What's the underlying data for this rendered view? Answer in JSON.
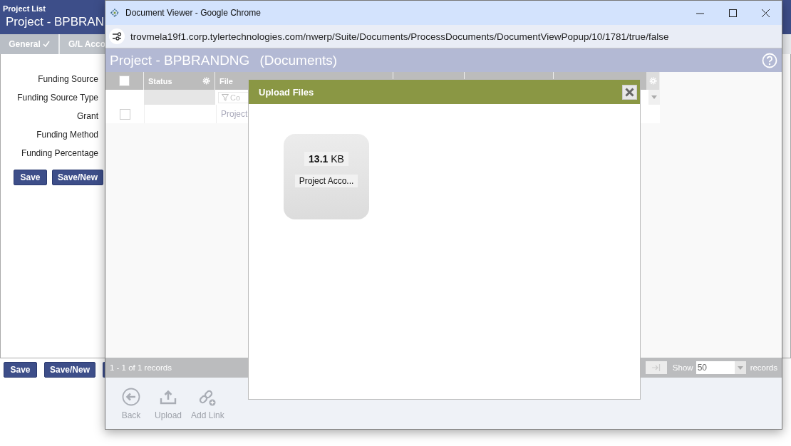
{
  "background_app": {
    "breadcrumb": "Project List",
    "title": "Project - BPBRAN",
    "tabs": [
      {
        "label": "General",
        "checked": true
      },
      {
        "label": "G/L Acco"
      }
    ],
    "form_labels": [
      "Funding Source",
      "Funding Source Type",
      "Grant",
      "Funding Method",
      "Funding Percentage"
    ],
    "form_buttons": [
      "Save",
      "Save/New"
    ],
    "footer_buttons": [
      "Save",
      "Save/New"
    ]
  },
  "browser_window": {
    "title": "Document Viewer - Google Chrome",
    "url": "trovmela19f1.corp.tylertechnologies.com/nwerp/Suite/Documents/ProcessDocuments/DocumentViewPopup/10/1781/true/false"
  },
  "page": {
    "title": "Project - BPBRANDNG",
    "subtitle": "(Documents)",
    "grid": {
      "header_checkbox": {
        "checked": false
      },
      "columns": [
        {
          "label": "Status"
        },
        {
          "label": "File"
        }
      ],
      "filter_placeholder": "Co",
      "rows": [
        {
          "checked": false,
          "file": "Project"
        }
      ]
    },
    "pager": {
      "summary": "1 - 1 of 1 records",
      "show_label": "Show",
      "page_size": "50",
      "records_label": "records"
    },
    "toolbar": [
      {
        "label": "Back",
        "kind": "back",
        "disabled": true
      },
      {
        "label": "Upload",
        "kind": "upload",
        "disabled": true
      },
      {
        "label": "Add Link",
        "kind": "link",
        "disabled": true
      }
    ]
  },
  "dialog": {
    "title": "Upload Files",
    "files": [
      {
        "size": "**13.1** KB",
        "name": "Project Acco..."
      }
    ]
  }
}
